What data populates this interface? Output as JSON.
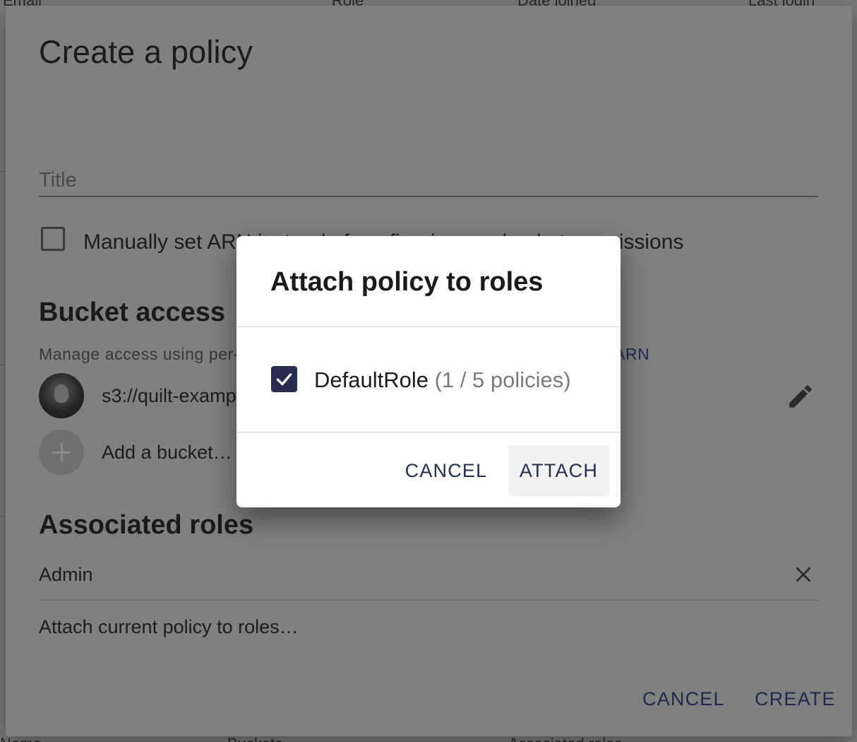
{
  "background_page": {
    "header_columns": [
      "Email",
      "Role",
      "Date joined",
      "Last login"
    ],
    "footer_columns": [
      "Name",
      "Buckets",
      "Associated roles"
    ]
  },
  "dialog": {
    "title": "Create a policy",
    "title_field": {
      "placeholder": "Title",
      "value": ""
    },
    "manual_arn_checkbox": {
      "checked": false,
      "label": "Manually set ARN instead of configuring per-bucket permissions"
    },
    "bucket_access": {
      "heading": "Bucket access",
      "hint": "Manage access using per-bucket permissions or set",
      "arn_link": "ARN",
      "buckets": [
        {
          "name": "s3://quilt-example"
        }
      ],
      "add_bucket_label": "Add a bucket…",
      "edit_icon": "pencil-icon"
    },
    "associated_roles": {
      "heading": "Associated roles",
      "roles": [
        {
          "name": "Admin"
        }
      ],
      "attach_hint": "Attach current policy to roles…",
      "remove_icon": "close-icon"
    },
    "actions": {
      "cancel": "CANCEL",
      "create": "CREATE"
    }
  },
  "modal": {
    "title": "Attach policy to roles",
    "roles": [
      {
        "name": "DefaultRole",
        "policies": "(1 / 5 policies)",
        "checked": true
      }
    ],
    "actions": {
      "cancel": "CANCEL",
      "attach": "ATTACH"
    }
  },
  "colors": {
    "overlay": "#7a7a7a",
    "dialog_bg": "#808080",
    "primary": "#262d4f",
    "modal_bg": "#ffffff"
  }
}
